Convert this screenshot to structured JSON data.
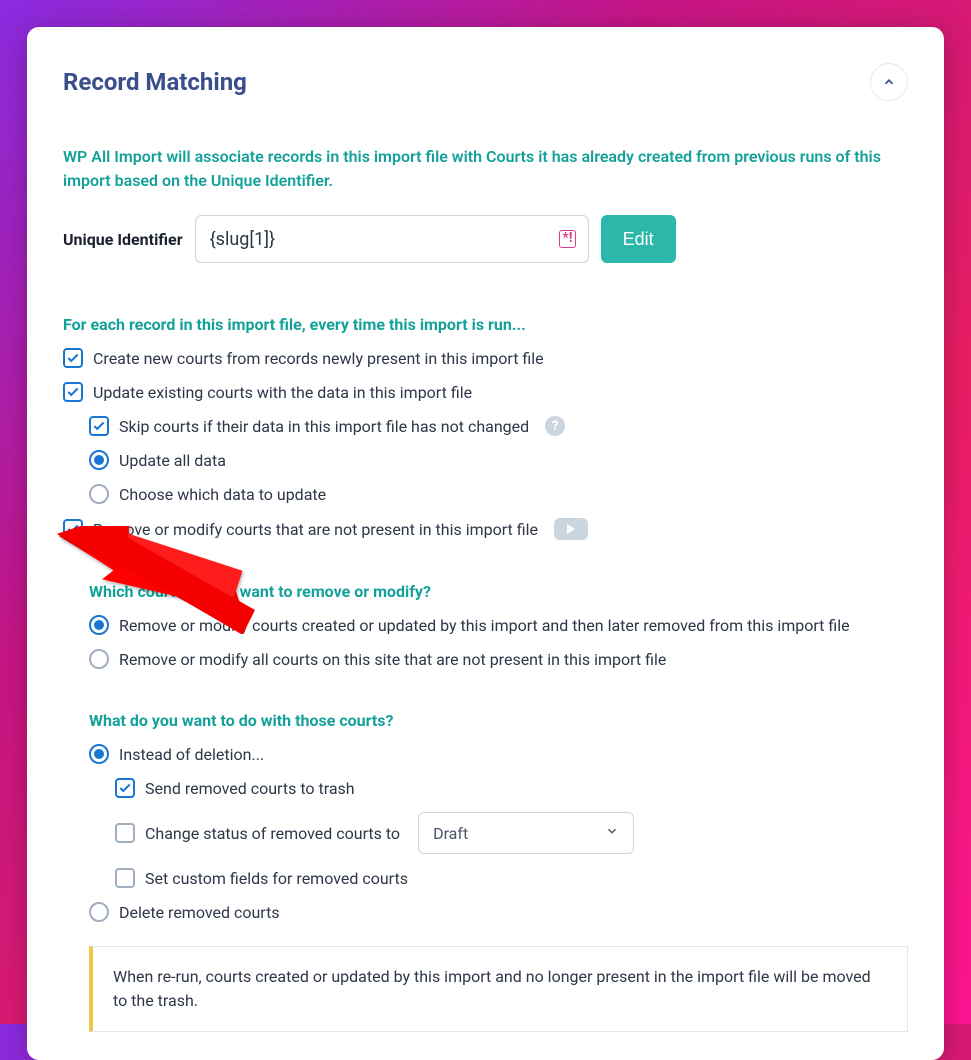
{
  "section": {
    "title": "Record Matching",
    "description": "WP All Import will associate records in this import file with Courts it has already created from previous runs of this import based on the Unique Identifier."
  },
  "uid": {
    "label": "Unique Identifier",
    "value": "{slug[1]}",
    "edit_label": "Edit"
  },
  "for_each": {
    "heading": "For each record in this import file, every time this import is run...",
    "create": "Create new courts from records newly present in this import file",
    "update": "Update existing courts with the data in this import file",
    "skip": "Skip courts if their data in this import file has not changed",
    "update_all": "Update all data",
    "choose_data": "Choose which data to update",
    "remove": "Remove or modify courts that are not present in this import file"
  },
  "which": {
    "heading": "Which courts do you want to remove or modify?",
    "opt1": "Remove or modify courts created or updated by this import and then later removed from this import file",
    "opt2": "Remove or modify all courts on this site that are not present in this import file"
  },
  "what": {
    "heading": "What do you want to do with those courts?",
    "instead": "Instead of deletion...",
    "trash": "Send removed courts to trash",
    "change_status": "Change status of removed courts to",
    "status_value": "Draft",
    "custom_fields": "Set custom fields for removed courts",
    "delete": "Delete removed courts"
  },
  "info": {
    "text": "When re-run, courts created or updated by this import and no longer present in the import file will be moved to the trash."
  }
}
